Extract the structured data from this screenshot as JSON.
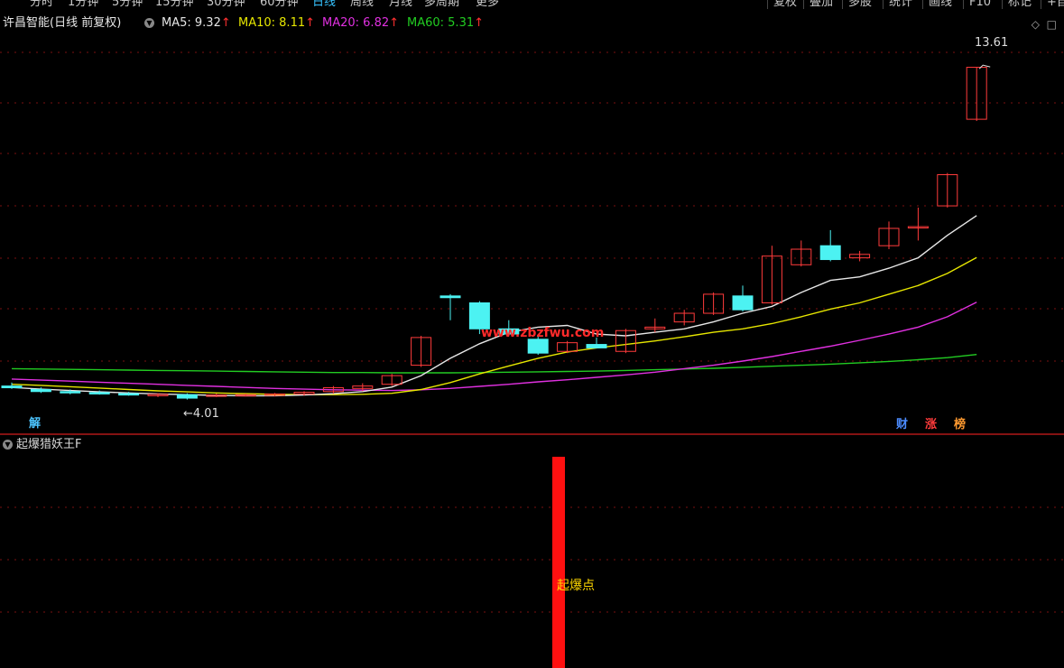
{
  "toolbar": {
    "periods": [
      "分时",
      "1分钟",
      "5分钟",
      "15分钟",
      "30分钟",
      "60分钟",
      "日线",
      "周线",
      "月线",
      "多周期",
      "更多"
    ],
    "active_period": "日线",
    "buttons": [
      "复权",
      "叠加",
      "多股",
      "统计",
      "画线",
      "F10",
      "标记",
      "+自"
    ]
  },
  "legend": {
    "title": "许昌智能(日线 前复权)",
    "ma5": "MA5: 9.32",
    "ma10": "MA10: 8.11",
    "ma20": "MA20: 6.82",
    "ma60": "MA60: 5.31",
    "arrow": "↑"
  },
  "markers": {
    "left_mark": "解",
    "cai": "财",
    "zhang": "涨",
    "bang": "榜"
  },
  "price_high_label": "13.61",
  "price_low_label": "4.01",
  "watermark": "www.zbzfwu.com",
  "indicator": {
    "title": "起爆猎妖王F",
    "signal_label": "起爆点"
  },
  "colors": {
    "up": "#ff3b3b",
    "down": "#4cf2f2",
    "ma5": "#e6e6e6",
    "ma10": "#e6e600",
    "ma20": "#e030e0",
    "ma60": "#22cc22",
    "signal": "#ff1010"
  },
  "chart_data": {
    "type": "candlestick",
    "y_range": [
      3.4,
      14.5
    ],
    "candles": [
      {
        "o": 4.4,
        "h": 4.5,
        "l": 4.32,
        "c": 4.35
      },
      {
        "o": 4.3,
        "h": 4.36,
        "l": 4.2,
        "c": 4.24
      },
      {
        "o": 4.24,
        "h": 4.3,
        "l": 4.16,
        "c": 4.22
      },
      {
        "o": 4.21,
        "h": 4.27,
        "l": 4.15,
        "c": 4.18
      },
      {
        "o": 4.18,
        "h": 4.23,
        "l": 4.12,
        "c": 4.14
      },
      {
        "o": 4.12,
        "h": 4.19,
        "l": 4.08,
        "c": 4.16
      },
      {
        "o": 4.15,
        "h": 4.19,
        "l": 4.01,
        "c": 4.05
      },
      {
        "o": 4.12,
        "h": 4.18,
        "l": 4.08,
        "c": 4.14
      },
      {
        "o": 4.13,
        "h": 4.18,
        "l": 4.1,
        "c": 4.15
      },
      {
        "o": 4.14,
        "h": 4.2,
        "l": 4.1,
        "c": 4.17
      },
      {
        "o": 4.17,
        "h": 4.25,
        "l": 4.12,
        "c": 4.22
      },
      {
        "o": 4.24,
        "h": 4.4,
        "l": 4.18,
        "c": 4.35
      },
      {
        "o": 4.33,
        "h": 4.48,
        "l": 4.25,
        "c": 4.4
      },
      {
        "o": 4.45,
        "h": 4.75,
        "l": 4.4,
        "c": 4.7
      },
      {
        "o": 5.0,
        "h": 5.85,
        "l": 4.95,
        "c": 5.8
      },
      {
        "o": 7.0,
        "h": 7.05,
        "l": 6.3,
        "c": 6.95
      },
      {
        "o": 6.8,
        "h": 6.85,
        "l": 5.9,
        "c": 6.05
      },
      {
        "o": 6.05,
        "h": 6.3,
        "l": 5.85,
        "c": 5.9
      },
      {
        "o": 5.75,
        "h": 5.85,
        "l": 5.3,
        "c": 5.35
      },
      {
        "o": 5.4,
        "h": 5.7,
        "l": 5.35,
        "c": 5.65
      },
      {
        "o": 5.6,
        "h": 5.8,
        "l": 5.5,
        "c": 5.5
      },
      {
        "o": 5.4,
        "h": 6.05,
        "l": 5.35,
        "c": 6.0
      },
      {
        "o": 6.05,
        "h": 6.35,
        "l": 5.95,
        "c": 6.1
      },
      {
        "o": 6.25,
        "h": 6.6,
        "l": 6.15,
        "c": 6.5
      },
      {
        "o": 6.5,
        "h": 7.1,
        "l": 6.45,
        "c": 7.05
      },
      {
        "o": 7.0,
        "h": 7.3,
        "l": 6.55,
        "c": 6.6
      },
      {
        "o": 6.8,
        "h": 8.45,
        "l": 6.75,
        "c": 8.15
      },
      {
        "o": 7.9,
        "h": 8.6,
        "l": 7.85,
        "c": 8.35
      },
      {
        "o": 8.45,
        "h": 8.9,
        "l": 8.0,
        "c": 8.05
      },
      {
        "o": 8.1,
        "h": 8.3,
        "l": 8.0,
        "c": 8.2
      },
      {
        "o": 8.45,
        "h": 9.15,
        "l": 8.35,
        "c": 8.95
      },
      {
        "o": 9.0,
        "h": 9.55,
        "l": 8.6,
        "c": 9.0
      },
      {
        "o": 9.6,
        "h": 10.55,
        "l": 9.55,
        "c": 10.5
      },
      {
        "o": 12.1,
        "h": 13.61,
        "l": 12.05,
        "c": 13.6
      }
    ],
    "ma5": [
      4.36,
      4.31,
      4.27,
      4.23,
      4.2,
      4.17,
      4.15,
      4.13,
      4.12,
      4.12,
      4.14,
      4.18,
      4.24,
      4.37,
      4.7,
      5.2,
      5.62,
      5.95,
      6.1,
      6.15,
      5.9,
      5.85,
      5.95,
      6.05,
      6.25,
      6.5,
      6.7,
      7.1,
      7.45,
      7.55,
      7.8,
      8.1,
      8.75,
      9.32
    ],
    "ma10": [
      4.45,
      4.42,
      4.38,
      4.34,
      4.3,
      4.26,
      4.23,
      4.2,
      4.18,
      4.16,
      4.15,
      4.15,
      4.16,
      4.19,
      4.3,
      4.5,
      4.75,
      4.98,
      5.2,
      5.38,
      5.5,
      5.6,
      5.7,
      5.82,
      5.95,
      6.05,
      6.2,
      6.4,
      6.62,
      6.8,
      7.05,
      7.3,
      7.65,
      8.11
    ],
    "ma20": [
      4.6,
      4.57,
      4.54,
      4.51,
      4.48,
      4.45,
      4.42,
      4.39,
      4.36,
      4.33,
      4.31,
      4.29,
      4.28,
      4.27,
      4.29,
      4.33,
      4.39,
      4.45,
      4.52,
      4.58,
      4.65,
      4.72,
      4.8,
      4.9,
      5.0,
      5.12,
      5.25,
      5.4,
      5.55,
      5.72,
      5.9,
      6.1,
      6.4,
      6.82
    ],
    "ma60": [
      4.9,
      4.89,
      4.88,
      4.87,
      4.86,
      4.85,
      4.84,
      4.83,
      4.82,
      4.81,
      4.8,
      4.79,
      4.79,
      4.78,
      4.78,
      4.78,
      4.79,
      4.8,
      4.81,
      4.82,
      4.83,
      4.85,
      4.87,
      4.89,
      4.91,
      4.94,
      4.97,
      5.0,
      5.03,
      5.07,
      5.11,
      5.16,
      5.22,
      5.31
    ],
    "signal_index": 19
  }
}
